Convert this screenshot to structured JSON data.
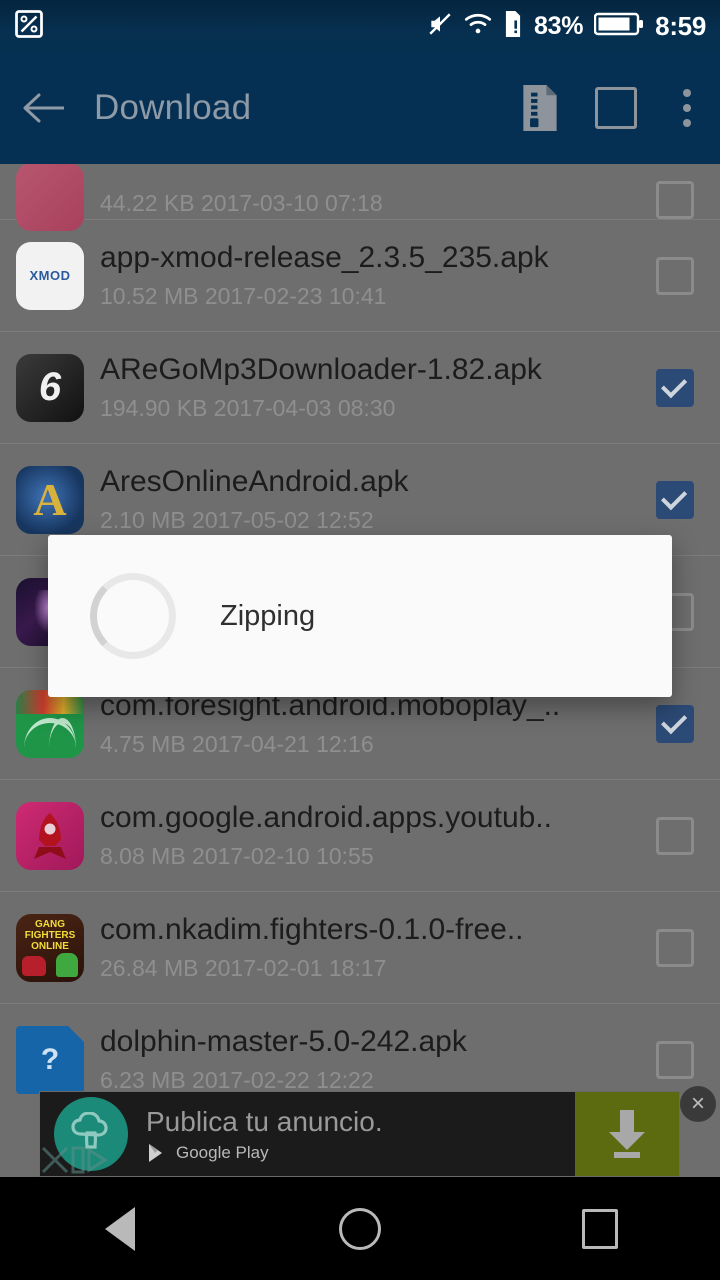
{
  "statusbar": {
    "left_icon": "image-edit-icon",
    "icons": [
      "mute-icon",
      "wifi-icon",
      "sd-card-alert-icon"
    ],
    "battery_percent": "83%",
    "battery_icon": "battery-icon",
    "time": "8:59"
  },
  "toolbar": {
    "back_icon": "arrow-left-icon",
    "title": "Download",
    "zip_icon": "zip-file-icon",
    "select_icon": "select-all-square-icon",
    "overflow_icon": "more-vertical-icon"
  },
  "colors": {
    "toolbar_bg": "#063053",
    "list_dim_bg": "#6e6e6e",
    "checkbox_checked": "#2b4a75",
    "dialog_bg": "#fafafa",
    "ad_cta_bg": "#5d6b10",
    "navbar_bg": "#000000"
  },
  "files": [
    {
      "name": "",
      "meta": "44.22 KB 2017-03-10 07:18",
      "checked": false,
      "icon": "app-icon-pink",
      "partial": true
    },
    {
      "name": "app-xmod-release_2.3.5_235.apk",
      "meta": "10.52 MB 2017-02-23 10:41",
      "checked": false,
      "icon": "app-icon-xmod",
      "icon_label": "XMOD"
    },
    {
      "name": "AReGoMp3Downloader-1.82.apk",
      "meta": "194.90 KB 2017-04-03 08:30",
      "checked": true,
      "icon": "app-icon-aregomp3",
      "icon_label": "6"
    },
    {
      "name": "AresOnlineAndroid.apk",
      "meta": "2.10 MB 2017-05-02 12:52",
      "checked": true,
      "icon": "app-icon-ares",
      "icon_label": "A"
    },
    {
      "name": "",
      "meta": "",
      "checked": false,
      "icon": "app-icon-purple"
    },
    {
      "name": "com.foresight.android.moboplay_..",
      "meta": "4.75 MB 2017-04-21 12:16",
      "checked": true,
      "icon": "app-icon-moboplay"
    },
    {
      "name": "com.google.android.apps.youtub..",
      "meta": "8.08 MB 2017-02-10 10:55",
      "checked": false,
      "icon": "app-icon-rocket"
    },
    {
      "name": "com.nkadim.fighters-0.1.0-free..",
      "meta": "26.84 MB 2017-02-01 18:17",
      "checked": false,
      "icon": "app-icon-gangfighters",
      "icon_label": "GANG FIGHTERS ONLINE"
    },
    {
      "name": "dolphin-master-5.0-242.apk",
      "meta": "6.23 MB 2017-02-22 12:22",
      "checked": false,
      "icon": "app-icon-unknown-doc",
      "icon_label": "?"
    }
  ],
  "dialog": {
    "message": "Zipping",
    "spinner_icon": "loading-spinner-icon"
  },
  "ad": {
    "logo_icon": "cloud-tree-logo-icon",
    "title": "Publica tu anuncio.",
    "source": "Google Play",
    "source_icon": "google-play-icon",
    "cta_icon": "download-arrow-icon",
    "close_label": "×",
    "badge_icon": "ad-choices-icon"
  },
  "navbar": {
    "back_icon": "nav-back-triangle-icon",
    "home_icon": "nav-home-circle-icon",
    "recents_icon": "nav-recents-square-icon"
  }
}
